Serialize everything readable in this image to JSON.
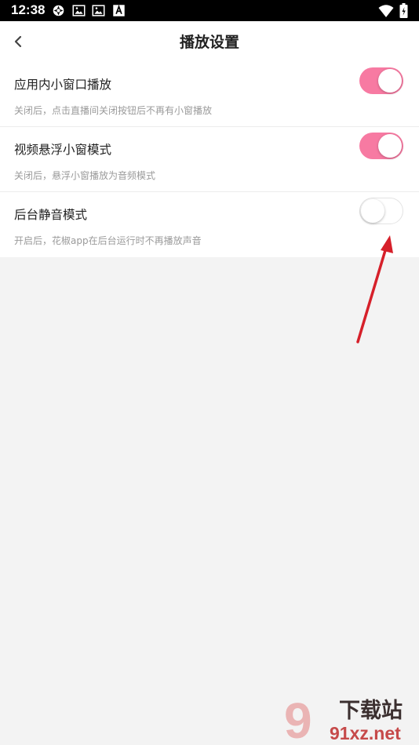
{
  "status_bar": {
    "time": "12:38",
    "icons": [
      "settings-icon",
      "gallery-icon",
      "gallery-icon",
      "font-icon",
      "wifi-icon",
      "battery-icon"
    ]
  },
  "header": {
    "title": "播放设置",
    "back_icon": "chevron-left-icon"
  },
  "settings": [
    {
      "title": "应用内小窗口播放",
      "description": "关闭后，点击直播间关闭按钮后不再有小窗播放",
      "enabled": true
    },
    {
      "title": "视频悬浮小窗模式",
      "description": "关闭后，悬浮小窗播放为音频模式",
      "enabled": true
    },
    {
      "title": "后台静音模式",
      "description": "开启后，花椒app在后台运行时不再播放声音",
      "enabled": false
    }
  ],
  "colors": {
    "accent": "#f77aa2",
    "background": "#f3f3f3",
    "annotation_arrow": "#d6202a"
  },
  "watermark": {
    "logo": "9",
    "text": "下载站",
    "url": "91xz.net"
  }
}
